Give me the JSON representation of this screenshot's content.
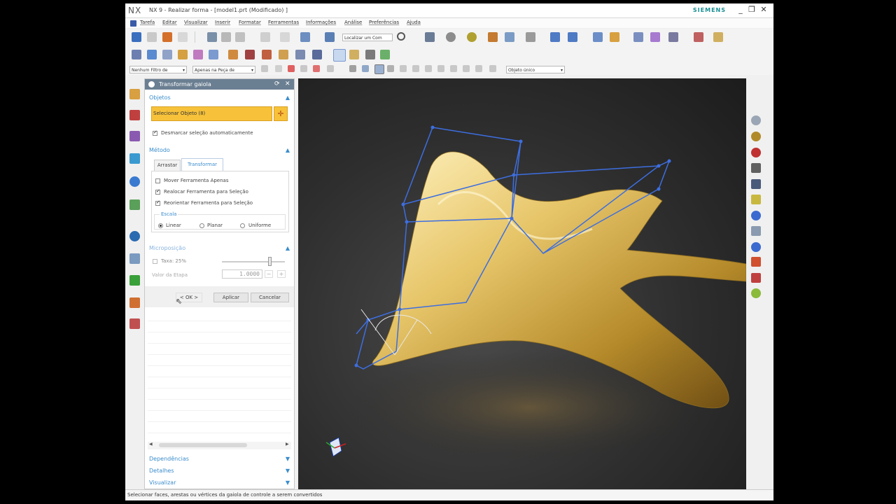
{
  "window": {
    "logo": "NX",
    "title": "NX 9 - Realizar forma - [model1.prt (Modificado) ]",
    "brand": "SIEMENS",
    "minimize": "_",
    "restore": "❐",
    "close": "✕"
  },
  "menu": {
    "items": [
      "Tarefa",
      "Editar",
      "Visualizar",
      "Inserir",
      "Formatar",
      "Ferramentas",
      "Informações",
      "Análise",
      "Preferências",
      "Ajuda"
    ]
  },
  "toolbar": {
    "search_placeholder": "Localizar um Com",
    "filter_type": "Nenhum Filtro de",
    "filter_scope": "Apenas na Peça de",
    "selection_mode": "Objeto único"
  },
  "dialog": {
    "title": "Transformar gaiola",
    "sections": {
      "objects": "Objetos",
      "method": "Método",
      "micropos": "Microposição",
      "dependencies": "Dependências",
      "details": "Detalhes",
      "visualize": "Visualizar"
    },
    "select_object": "Selecionar Objeto (8)",
    "auto_deselect": "Desmarcar seleção automaticamente",
    "tabs": [
      "Arrastar",
      "Transformar"
    ],
    "options": {
      "move_tool_only": "Mover Ferramenta Apenas",
      "relocate_tool": "Realocar Ferramenta para Seleção",
      "reorient_tool": "Reorientar Ferramenta para Seleção"
    },
    "scale_group": "Escala",
    "scale_options": [
      "Linear",
      "Planar",
      "Uniforme"
    ],
    "rate_label": "Taxa: 25%",
    "rate_value": 0.75,
    "step_label": "Valor da Etapa",
    "step_value": "1.0000",
    "buttons": {
      "ok": "< OK >",
      "apply": "Aplicar",
      "cancel": "Cancelar"
    }
  },
  "status": {
    "text": "Selecionar faces, arestas ou vértices da gaiola de controle a serem convertidos"
  },
  "colors": {
    "accent_blue": "#3b8dcc",
    "selected_field": "#f7c23a",
    "cage": "#3d6ee0",
    "gold": "#d9b64a",
    "dialog_title": "#6b7f92"
  }
}
